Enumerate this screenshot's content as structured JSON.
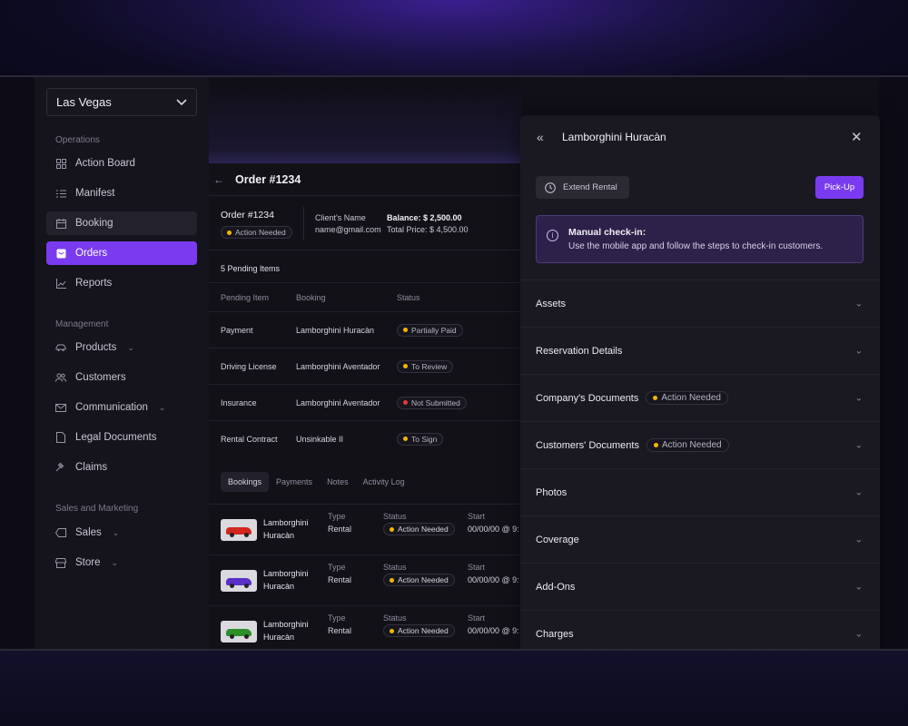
{
  "sidebar": {
    "location": "Las Vegas",
    "sections": [
      {
        "label": "Operations"
      },
      {
        "label": "Management"
      },
      {
        "label": "Sales and Marketing"
      }
    ],
    "items": {
      "action_board": "Action Board",
      "manifest": "Manifest",
      "booking": "Booking",
      "orders": "Orders",
      "reports": "Reports",
      "products": "Products",
      "customers": "Customers",
      "communication": "Communication",
      "legal_documents": "Legal Documents",
      "claims": "Claims",
      "sales": "Sales",
      "store": "Store"
    }
  },
  "order": {
    "header_title": "Order #1234",
    "number": "Order #1234",
    "status": "Action Needed",
    "client_name_label": "Client's Name",
    "client_email": "name@gmail.com",
    "balance": "Balance: $ 2,500.00",
    "total": "Total Price: $ 4,500.00",
    "pending_title": "5 Pending Items",
    "pending_headers": [
      "Pending Item",
      "Booking",
      "Status"
    ],
    "pending_rows": [
      {
        "item": "Payment",
        "booking": "Lamborghini Huracàn",
        "status": "Partially Paid",
        "dot": "#f2b705"
      },
      {
        "item": "Driving License",
        "booking": "Lamborghini Aventador",
        "status": "To Review",
        "dot": "#f2b705"
      },
      {
        "item": "Insurance",
        "booking": "Lamborghini Aventador",
        "status": "Not Submitted",
        "dot": "#e5383b"
      },
      {
        "item": "Rental Contract",
        "booking": "Unsinkable II",
        "status": "To Sign",
        "dot": "#f2b705"
      }
    ],
    "tabs": [
      "Bookings",
      "Payments",
      "Notes",
      "Activity Log"
    ],
    "bookings": [
      {
        "name1": "Lamborghini",
        "name2": "Huracàn",
        "type_label": "Type",
        "type": "Rental",
        "status_label": "Status",
        "status": "Action Needed",
        "start_label": "Start",
        "start": "00/00/00 @ 9:",
        "car_color": "#d3261f"
      },
      {
        "name1": "Lamborghini",
        "name2": "Huracàn",
        "type_label": "Type",
        "type": "Rental",
        "status_label": "Status",
        "status": "Action Needed",
        "start_label": "Start",
        "start": "00/00/00 @ 9:",
        "car_color": "#5a2fc9"
      },
      {
        "name1": "Lamborghini",
        "name2": "Huracàn",
        "type_label": "Type",
        "type": "Rental",
        "status_label": "Status",
        "status": "Action Needed",
        "start_label": "Start",
        "start": "00/00/00 @ 9:",
        "car_color": "#2e8f2a"
      }
    ]
  },
  "panel": {
    "title": "Lamborghini Huracàn",
    "extend_label": "Extend Rental",
    "pickup_label": "Pick-Up",
    "notice_title": "Manual check-in:",
    "notice_text": "Use the mobile app and follow the steps to check-in customers.",
    "sections": [
      {
        "label": "Assets",
        "badge": ""
      },
      {
        "label": "Reservation Details",
        "badge": ""
      },
      {
        "label": "Company's Documents",
        "badge": "Action Needed"
      },
      {
        "label": "Customers' Documents",
        "badge": "Action Needed"
      },
      {
        "label": "Photos",
        "badge": ""
      },
      {
        "label": "Coverage",
        "badge": ""
      },
      {
        "label": "Add-Ons",
        "badge": ""
      },
      {
        "label": "Charges",
        "badge": ""
      }
    ]
  },
  "colors": {
    "accent": "#7a3bf0",
    "warning": "#f2b705",
    "danger": "#e5383b"
  }
}
